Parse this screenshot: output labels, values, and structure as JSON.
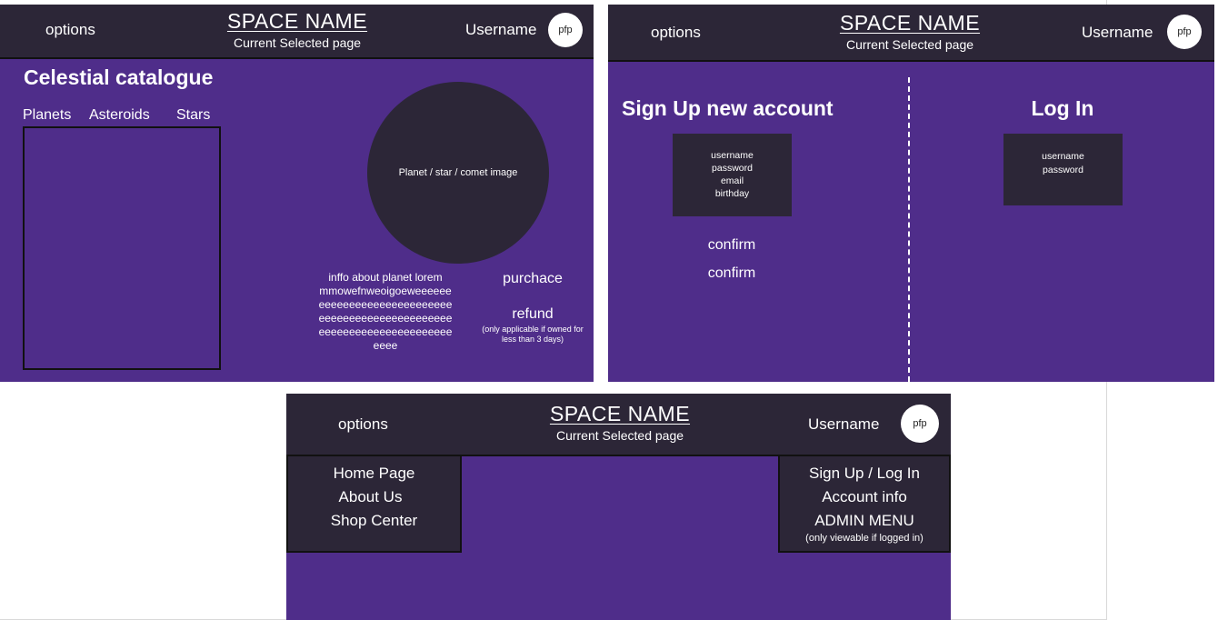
{
  "header": {
    "options_label": "options",
    "space_name": "SPACE NAME",
    "current_page": "Current Selected page",
    "username": "Username",
    "pfp": "pfp"
  },
  "catalogue": {
    "title": "Celestial catalogue",
    "tabs": [
      "Planets",
      "Asteroids",
      "Stars"
    ],
    "image_label": "Planet / star / comet image",
    "info_lines": [
      "inffo about planet lorem",
      "mmowefnweoigoeweeeeee",
      "eeeeeeeeeeeeeeeeeeeeee",
      "eeeeeeeeeeeeeeeeeeeeee",
      "eeeeeeeeeeeeeeeeeeeeee",
      "eeee"
    ],
    "purchase_label": "purchace",
    "refund_label": "refund",
    "refund_note_line1": "(only applicable if owned for",
    "refund_note_line2": "less than 3 days)"
  },
  "auth": {
    "signup_title": "Sign Up new account",
    "signup_fields": [
      "username",
      "password",
      "email",
      "birthday"
    ],
    "confirm_1": "confirm",
    "confirm_2": "confirm",
    "login_title": "Log In",
    "login_fields": [
      "username",
      "password"
    ]
  },
  "menus": {
    "left_items": [
      "Home Page",
      "About Us",
      "Shop Center"
    ],
    "right_items": [
      "Sign Up / Log In",
      "Account info",
      "ADMIN MENU"
    ],
    "admin_note": "(only viewable if logged in)"
  },
  "colors": {
    "panel_purple": "#4f2d8a",
    "header_dark": "#2c2637",
    "box_dark": "#2c2637"
  }
}
